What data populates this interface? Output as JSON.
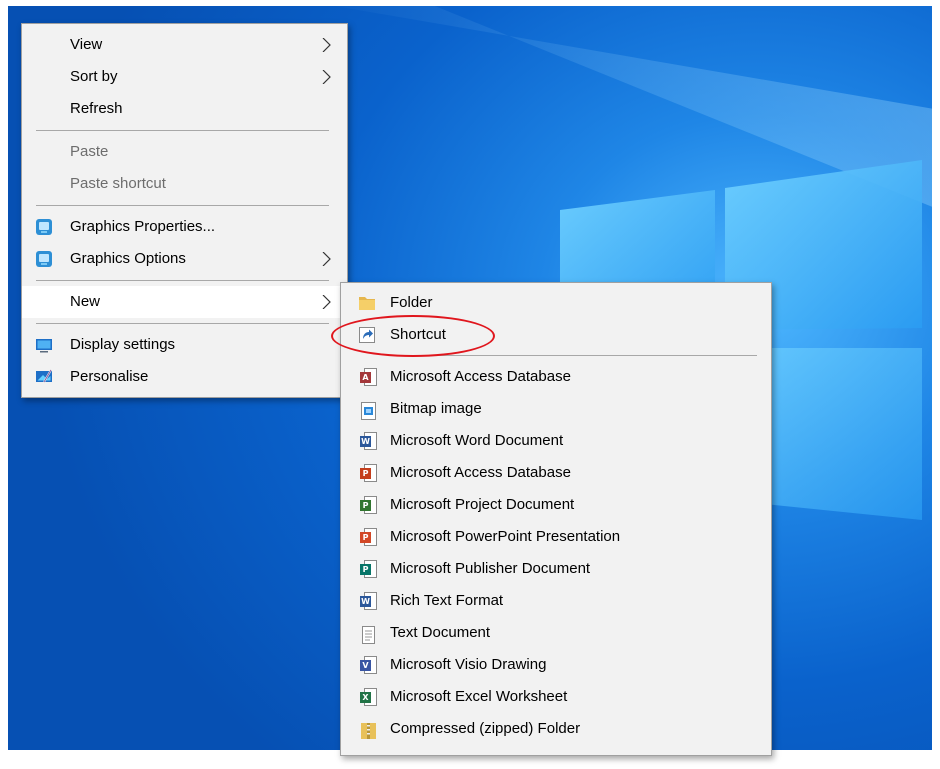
{
  "main_menu": {
    "view": "View",
    "sort_by": "Sort by",
    "refresh": "Refresh",
    "paste": "Paste",
    "paste_shortcut": "Paste shortcut",
    "graphics_properties": "Graphics Properties...",
    "graphics_options": "Graphics Options",
    "new": "New",
    "display_settings": "Display settings",
    "personalise": "Personalise"
  },
  "new_submenu": {
    "folder": "Folder",
    "shortcut": "Shortcut",
    "items": [
      {
        "label": "Microsoft Access Database",
        "icon": "access-icon",
        "color": "#a4373a",
        "letter": "A"
      },
      {
        "label": "Bitmap image",
        "icon": "bitmap-icon",
        "color": "#2b88d8",
        "letter": ""
      },
      {
        "label": "Microsoft Word Document",
        "icon": "word-icon",
        "color": "#2b579a",
        "letter": "W"
      },
      {
        "label": "Microsoft Access Database",
        "icon": "access-icon",
        "color": "#c43e1c",
        "letter": "P"
      },
      {
        "label": "Microsoft Project Document",
        "icon": "project-icon",
        "color": "#31752f",
        "letter": "P"
      },
      {
        "label": "Microsoft PowerPoint Presentation",
        "icon": "powerpoint-icon",
        "color": "#d24726",
        "letter": "P"
      },
      {
        "label": "Microsoft Publisher Document",
        "icon": "publisher-icon",
        "color": "#077568",
        "letter": "P"
      },
      {
        "label": "Rich Text Format",
        "icon": "rtf-icon",
        "color": "#2b579a",
        "letter": "W"
      },
      {
        "label": "Text Document",
        "icon": "text-document-icon",
        "color": "#ffffff",
        "letter": ""
      },
      {
        "label": "Microsoft Visio Drawing",
        "icon": "visio-icon",
        "color": "#3955a3",
        "letter": "V"
      },
      {
        "label": "Microsoft Excel Worksheet",
        "icon": "excel-icon",
        "color": "#217346",
        "letter": "X"
      },
      {
        "label": "Compressed (zipped) Folder",
        "icon": "zip-folder-icon",
        "color": "#e8c15a",
        "letter": ""
      }
    ]
  },
  "colors": {
    "menu_bg": "#f2f2f2",
    "highlight_bg": "#ffffff",
    "annotation": "#e0161d"
  }
}
